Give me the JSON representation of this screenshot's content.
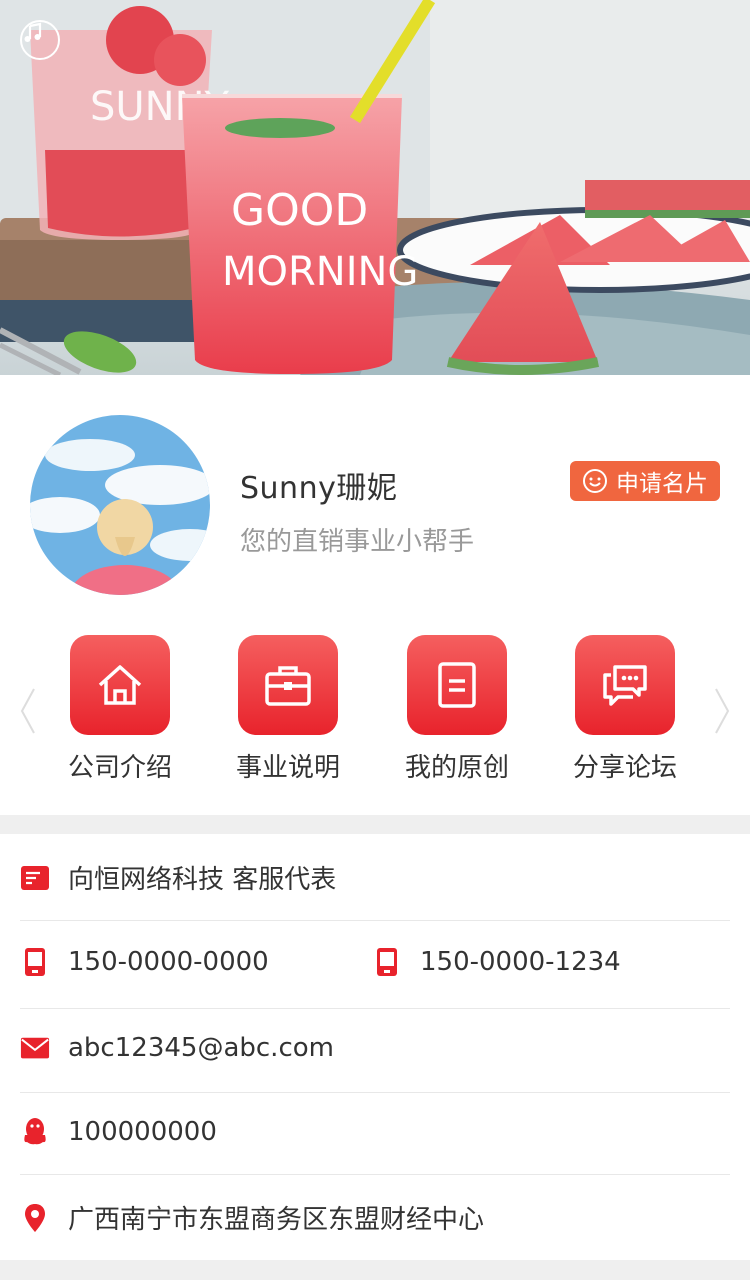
{
  "hero": {
    "music_icon": "music-note-icon",
    "glass_text_1": "SUNNY",
    "glass_text_2": "GOOD",
    "glass_text_3": "MORNING"
  },
  "profile": {
    "name": "Sunny珊妮",
    "tagline": "您的直销事业小帮手",
    "apply_button": "申请名片",
    "apply_icon": "smile-icon"
  },
  "quick_links": [
    {
      "label": "公司介绍",
      "icon": "home-icon"
    },
    {
      "label": "事业说明",
      "icon": "briefcase-icon"
    },
    {
      "label": "我的原创",
      "icon": "document-icon"
    },
    {
      "label": "分享论坛",
      "icon": "chat-bubbles-icon"
    }
  ],
  "contact": {
    "company": "向恒网络科技 客服代表",
    "phone_1": "150-0000-0000",
    "phone_2": "150-0000-1234",
    "email": "abc12345@abc.com",
    "qq": "100000000",
    "address": "广西南宁市东盟商务区东盟财经中心"
  },
  "colors": {
    "accent_red": "#e8232c",
    "apply_orange": "#f0663f"
  }
}
